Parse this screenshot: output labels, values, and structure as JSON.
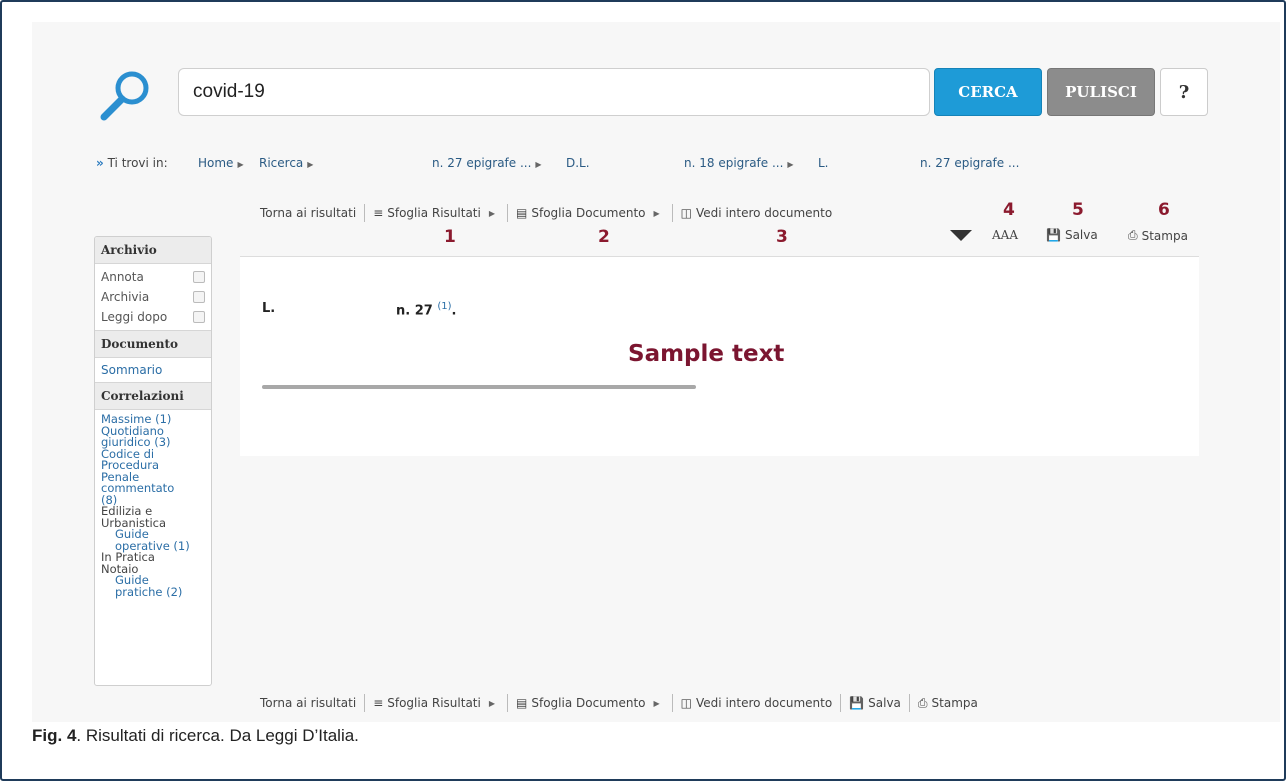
{
  "search": {
    "value": "covid-19",
    "cerca_label": "CERCA",
    "pulisci_label": "PULISCI",
    "help_label": "?"
  },
  "breadcrumb": {
    "prefix": "Ti trovi in:",
    "items": [
      "Home",
      "Ricerca",
      "n. 27 epigrafe ...",
      "D.L.",
      "n. 18 epigrafe ...",
      "L.",
      "n. 27 epigrafe ..."
    ]
  },
  "toolbar": {
    "torna": "Torna ai risultati",
    "sfoglia_risultati": "Sfoglia Risultati",
    "sfoglia_documento": "Sfoglia Documento",
    "vedi_intero": "Vedi intero documento",
    "font_size": "AAA",
    "salva": "Salva",
    "stampa": "Stampa"
  },
  "annotations": [
    "1",
    "2",
    "3",
    "4",
    "5",
    "6"
  ],
  "sidebar": {
    "archivio_title": "Archivio",
    "archivio_items": [
      "Annota",
      "Archivia",
      "Leggi dopo"
    ],
    "documento_title": "Documento",
    "sommario": "Sommario",
    "correlazioni_title": "Correlazioni",
    "correlazioni": {
      "massime": "Massime (1)",
      "quotidiano": "Quotidiano giuridico (3)",
      "codice": "Codice di Procedura Penale commentato (8)",
      "edilizia": "Edilizia e Urbanistica",
      "guide_operative": "Guide operative (1)",
      "in_pratica": "In Pratica",
      "notaio": "Notaio",
      "guide_pratiche": "Guide pratiche (2)"
    }
  },
  "document": {
    "type": "L.",
    "number": "n. 27",
    "note_ref": "(1)",
    "sample_text": "Sample text"
  },
  "caption": {
    "label": "Fig. 4",
    "text": ". Risultati di ricerca. Da Leggi D’Italia."
  },
  "colors": {
    "cerca": "#1e9bd7",
    "pulisci": "#8c8c8c",
    "annotation": "#8b1a2e",
    "link": "#2b6ea6"
  }
}
